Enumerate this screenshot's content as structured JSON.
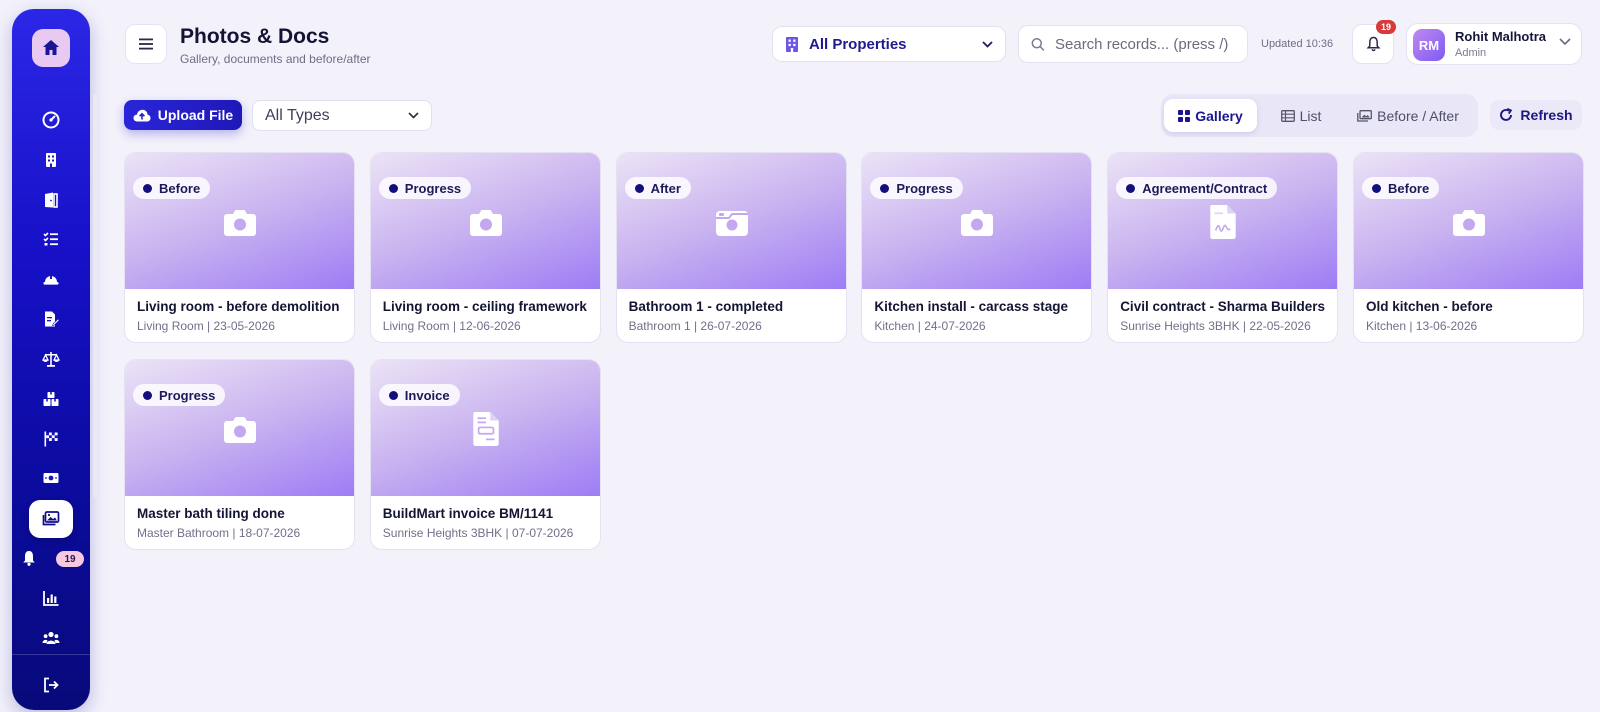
{
  "header": {
    "title": "Photos & Docs",
    "subtitle": "Gallery, documents and before/after",
    "property_select": "All Properties",
    "search_placeholder": "Search records... (press /)",
    "updated": "Updated 10:36",
    "notification_count": "19"
  },
  "user": {
    "initials": "RM",
    "name": "Rohit Malhotra",
    "role": "Admin"
  },
  "sidebar": {
    "items": [
      {
        "icon": "dashboard-icon"
      },
      {
        "icon": "building-icon"
      },
      {
        "icon": "door-icon"
      },
      {
        "icon": "checklist-icon"
      },
      {
        "icon": "hardhat-icon"
      },
      {
        "icon": "edit-doc-icon"
      },
      {
        "icon": "scale-icon"
      },
      {
        "icon": "boxes-icon"
      },
      {
        "icon": "flag-icon"
      },
      {
        "icon": "money-icon"
      },
      {
        "icon": "images-icon",
        "active": true
      },
      {
        "icon": "bell-icon"
      },
      {
        "icon": "chart-icon"
      },
      {
        "icon": "team-icon"
      }
    ],
    "bell_badge": "19",
    "logout_icon": "logout-icon"
  },
  "toolbar": {
    "upload_label": "Upload File",
    "type_filter": "All Types",
    "views": [
      "Gallery",
      "List",
      "Before / After"
    ],
    "active_view": "Gallery",
    "refresh_label": "Refresh"
  },
  "cards": [
    {
      "tag": "Before",
      "title": "Living room - before demolition",
      "meta": "Living Room | 23-05-2026",
      "icon": "camera-icon"
    },
    {
      "tag": "Progress",
      "title": "Living room - ceiling framework",
      "meta": "Living Room | 12-06-2026",
      "icon": "camera-icon"
    },
    {
      "tag": "After",
      "title": "Bathroom 1 - completed",
      "meta": "Bathroom 1 | 26-07-2026",
      "icon": "camera-retro-icon"
    },
    {
      "tag": "Progress",
      "title": "Kitchen install - carcass stage",
      "meta": "Kitchen | 24-07-2026",
      "icon": "camera-icon"
    },
    {
      "tag": "Agreement/Contract",
      "title": "Civil contract - Sharma Builders",
      "meta": "Sunrise Heights 3BHK | 22-05-2026",
      "icon": "contract-icon"
    },
    {
      "tag": "Before",
      "title": "Old kitchen - before",
      "meta": "Kitchen | 13-06-2026",
      "icon": "camera-icon"
    },
    {
      "tag": "Progress",
      "title": "Master bath tiling done",
      "meta": "Master Bathroom | 18-07-2026",
      "icon": "camera-icon"
    },
    {
      "tag": "Invoice",
      "title": "BuildMart invoice BM/1141",
      "meta": "Sunrise Heights 3BHK | 07-07-2026",
      "icon": "invoice-icon"
    }
  ]
}
